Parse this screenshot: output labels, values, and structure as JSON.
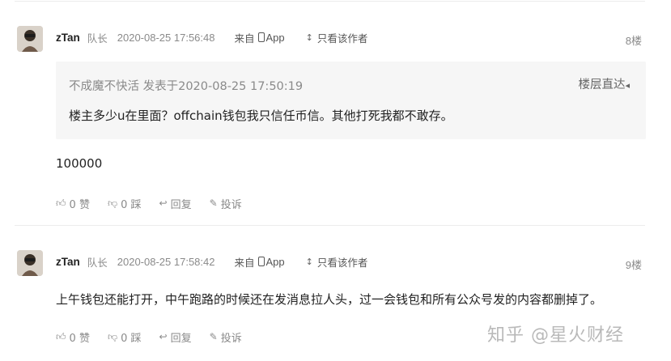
{
  "comments": [
    {
      "username": "zTan",
      "role": "队长",
      "time": "2020-08-25 17:56:48",
      "source_prefix": "来自",
      "source_app": "App",
      "visibility": "只看该作者",
      "floor": "8楼",
      "quote": {
        "header": "不成魔不快活 发表于2020-08-25 17:50:19",
        "link": "楼层直达",
        "body": "楼主多少u在里面？offchain钱包我只信任币信。其他打死我都不敢存。"
      },
      "content": "100000",
      "actions": {
        "like": "0 赞",
        "dislike": "0 踩",
        "reply": "回复",
        "report": "投诉"
      }
    },
    {
      "username": "zTan",
      "role": "队长",
      "time": "2020-08-25 17:58:42",
      "source_prefix": "来自",
      "source_app": "App",
      "visibility": "只看该作者",
      "floor": "9楼",
      "content": "上午钱包还能打开，中午跑路的时候还在发消息拉人头，过一会钱包和所有公众号发的内容都删掉了。",
      "actions": {
        "like": "0 赞",
        "dislike": "0 踩",
        "reply": "回复",
        "report": "投诉"
      }
    }
  ],
  "watermark": "知乎 @星火财经"
}
